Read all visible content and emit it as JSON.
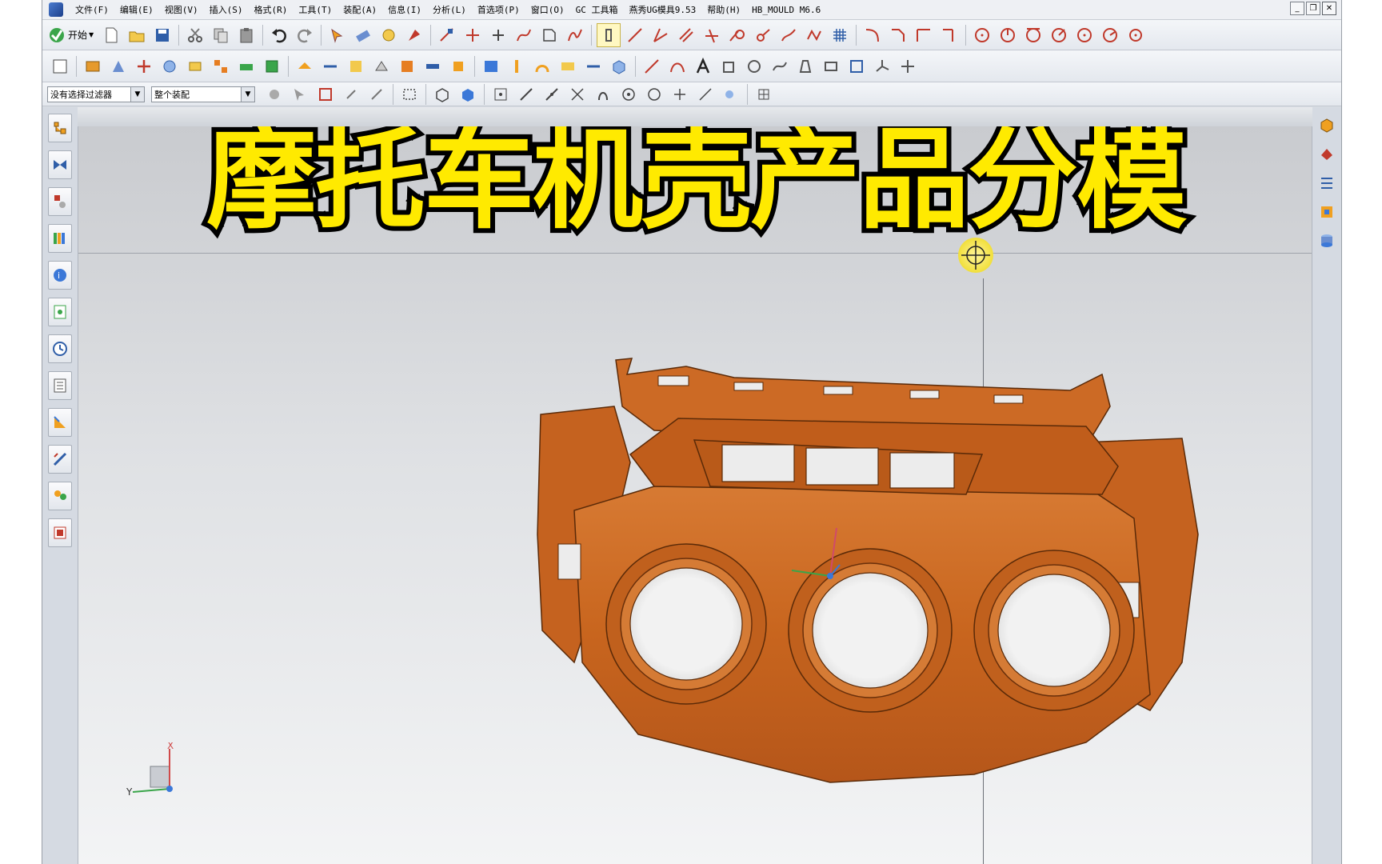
{
  "menubar": {
    "items": [
      "文件(F)",
      "编辑(E)",
      "视图(V)",
      "插入(S)",
      "格式(R)",
      "工具(T)",
      "装配(A)",
      "信息(I)",
      "分析(L)",
      "首选项(P)",
      "窗口(O)",
      "GC 工具箱",
      "燕秀UG模具9.53",
      "帮助(H)",
      "HB_MOULD M6.6"
    ],
    "window_buttons": [
      "_",
      "❐",
      "✕"
    ]
  },
  "toolbar": {
    "start_label": "开始"
  },
  "selection_bar": {
    "filter": "没有选择过滤器",
    "scope": "整个装配"
  },
  "overlay": {
    "title": "摩托车机壳产品分模"
  },
  "triad": {
    "x_label": "X",
    "y_label": "Y"
  },
  "colors": {
    "part": "#c8651e",
    "part_dark": "#8f3f0f",
    "title_fill": "#ffea00",
    "title_stroke": "#000000"
  }
}
